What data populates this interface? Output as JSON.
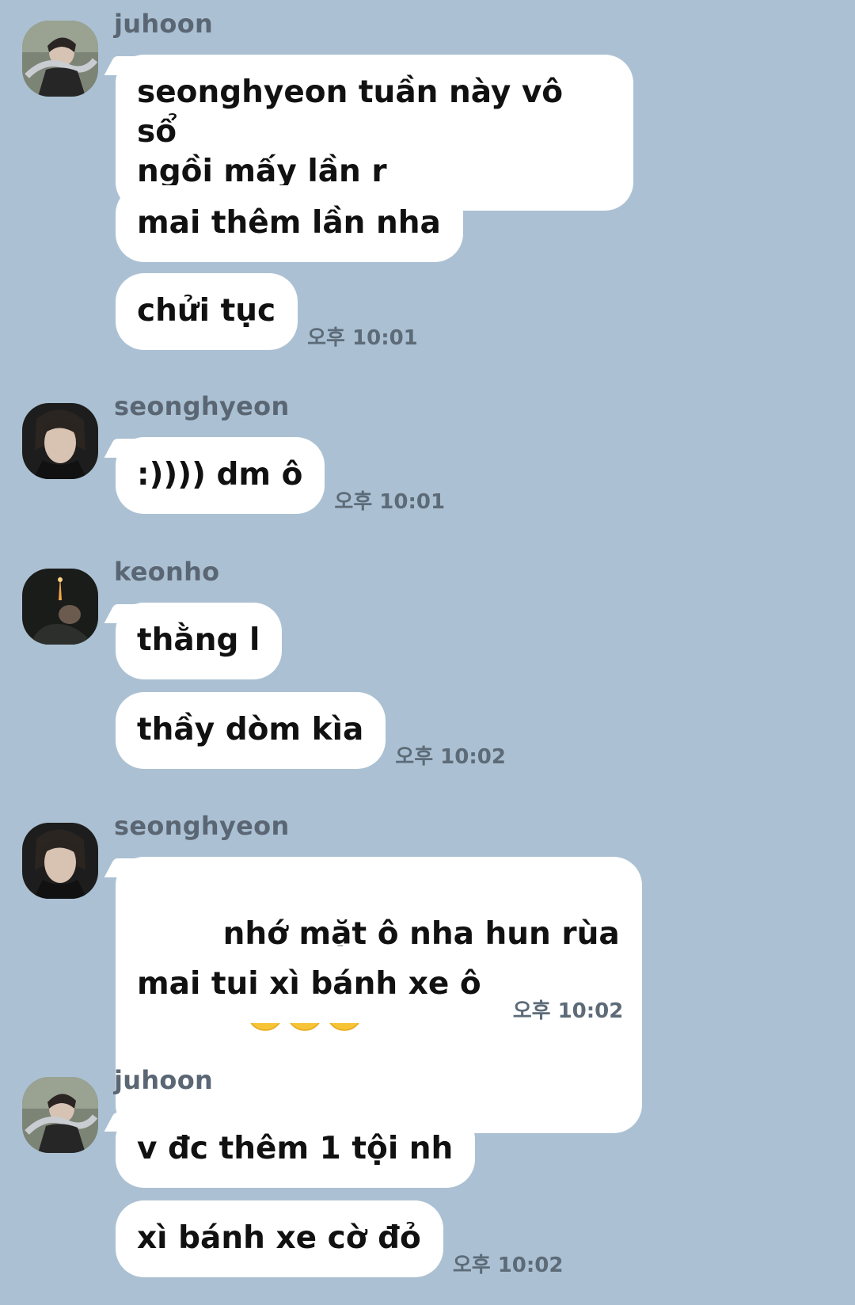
{
  "chat": {
    "groups": [
      {
        "sender": "juhoon",
        "avatar_icon": "profile-photo-juhoon",
        "messages": [
          "seonghyeon tuần này vô sổ\nngồi mấy lần r",
          "mai thêm lần nha",
          "chửi tục"
        ],
        "time": "오후 10:01"
      },
      {
        "sender": "seonghyeon",
        "avatar_icon": "profile-photo-seonghyeon",
        "messages": [
          ":)))) dm ô"
        ],
        "time": "오후 10:01"
      },
      {
        "sender": "keonho",
        "avatar_icon": "profile-photo-keonho",
        "messages": [
          "thằng l",
          "thầy dòm kìa"
        ],
        "time": "오후 10:02"
      },
      {
        "sender": "seonghyeon",
        "avatar_icon": "profile-photo-seonghyeon",
        "messages": [
          "nhớ mặt ô nha hun rùa",
          "mai tui xì bánh xe ô"
        ],
        "emoji": "slightly-smiling-face-icon",
        "time": "오후 10:02"
      },
      {
        "sender": "juhoon",
        "avatar_icon": "profile-photo-juhoon",
        "messages": [
          "v đc thêm 1 tội nh",
          "xì bánh xe cờ đỏ"
        ],
        "time": "오후 10:02"
      }
    ]
  },
  "colors": {
    "background": "#abc1d3",
    "bubble": "#ffffff",
    "sender_text": "#5a6673",
    "time_text": "#5d6b78"
  }
}
